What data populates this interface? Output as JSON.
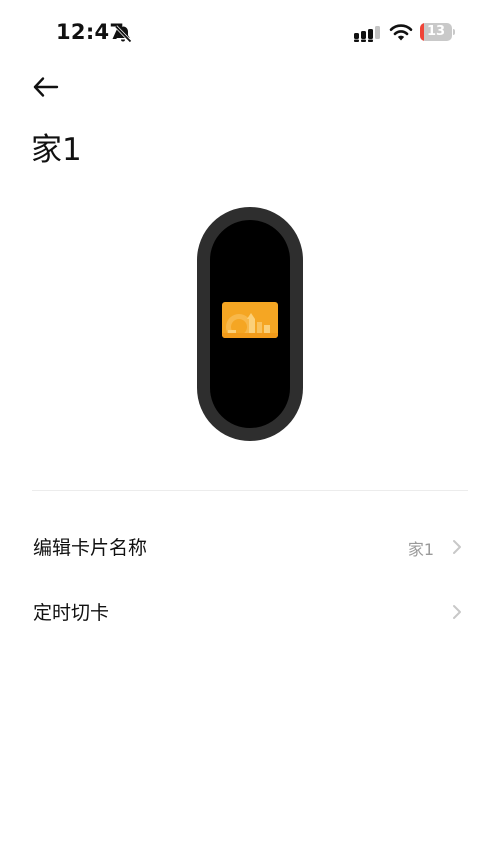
{
  "status_bar": {
    "time": "12:47",
    "battery_level": "13",
    "battery_fraction": 0.13,
    "icons": [
      "bell-off-icon",
      "signal-icon",
      "wifi-icon",
      "battery-icon"
    ]
  },
  "header": {
    "back_icon": "arrow-left-icon",
    "title": "家1"
  },
  "preview": {
    "device": "band",
    "card_icon": "card-thumbnail",
    "card_color": "#f5a623"
  },
  "settings": [
    {
      "label": "编辑卡片名称",
      "value": "家1",
      "icon": "chevron-right-icon"
    },
    {
      "label": "定时切卡",
      "value": "",
      "icon": "chevron-right-icon"
    }
  ],
  "colors": {
    "band_frame": "#2e2e2e",
    "band_screen": "#000000",
    "battery_low": "#f04438",
    "secondary_text": "#9a9a9a"
  }
}
